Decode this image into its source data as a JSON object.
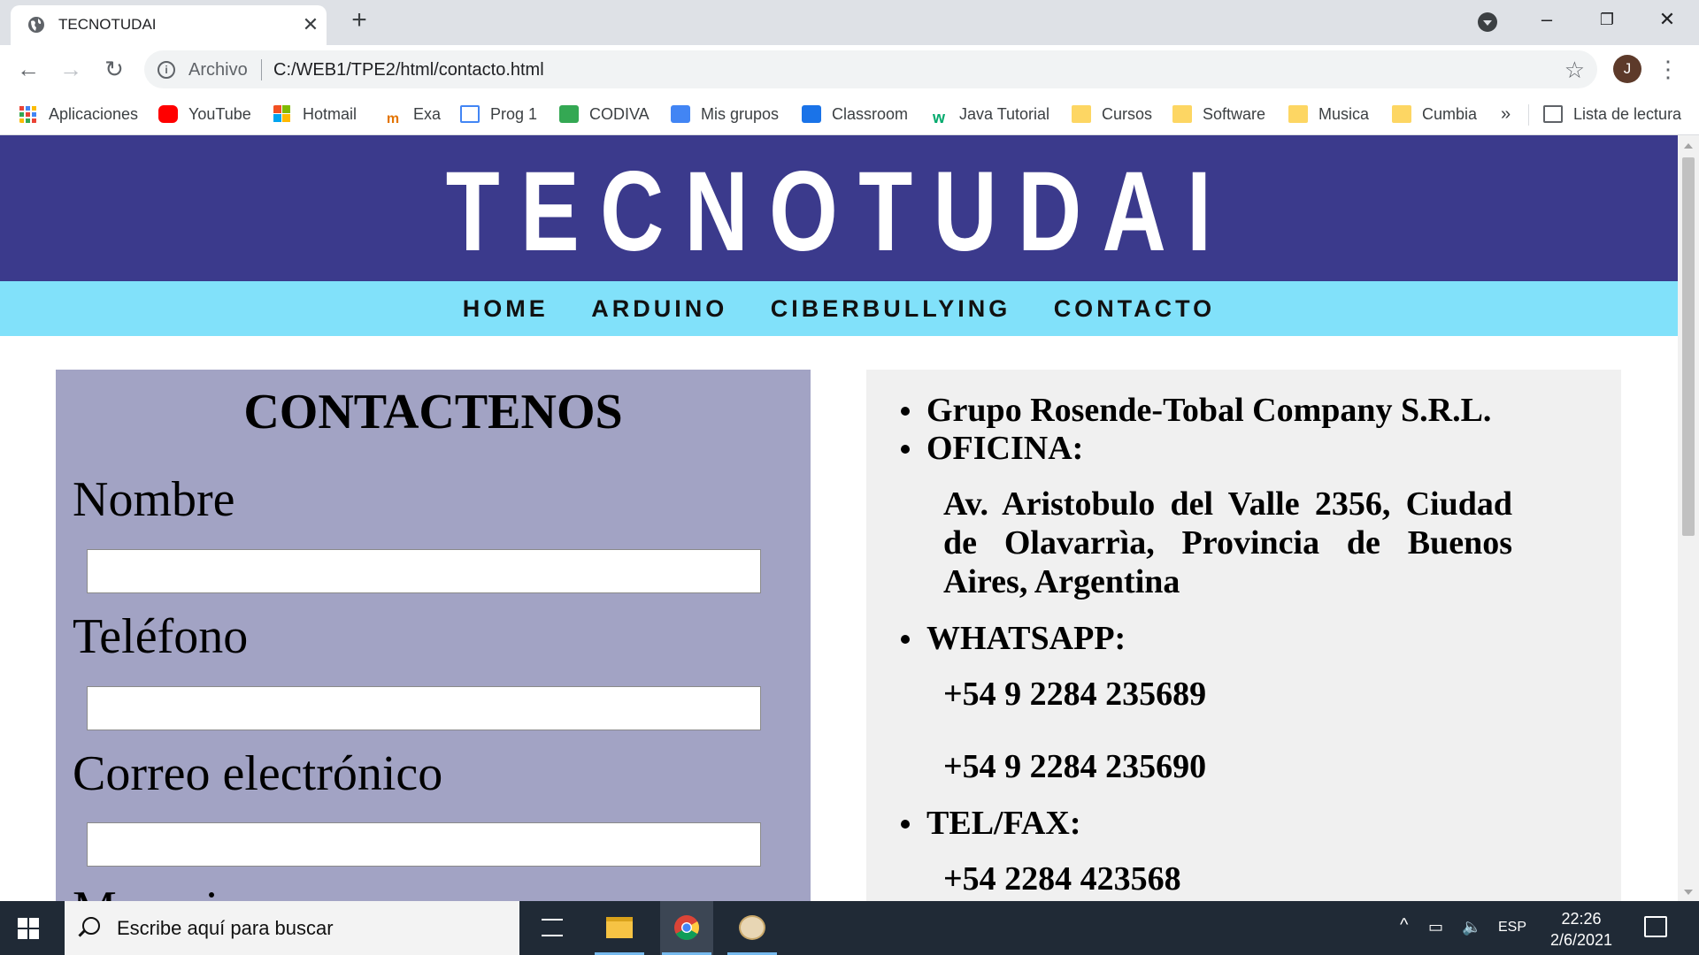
{
  "browser": {
    "tab_title": "TECNOTUDAI",
    "address_label": "Archivo",
    "url": "C:/WEB1/TPE2/html/contacto.html",
    "avatar_letter": "J",
    "bookmarks": [
      {
        "label": "Aplicaciones",
        "icon": "apps-grid-icon",
        "color": "#ea4335"
      },
      {
        "label": "YouTube",
        "icon": "youtube-icon",
        "color": "#ff0000"
      },
      {
        "label": "Hotmail",
        "icon": "microsoft-icon",
        "color": "#f25022"
      },
      {
        "label": "Exa",
        "icon": "exa-icon",
        "color": "#e37400"
      },
      {
        "label": "Prog 1",
        "icon": "prog-icon",
        "color": "#4285f4"
      },
      {
        "label": "CODIVA",
        "icon": "codiva-icon",
        "color": "#34a853"
      },
      {
        "label": "Mis grupos",
        "icon": "groups-icon",
        "color": "#4285f4"
      },
      {
        "label": "Classroom",
        "icon": "classroom-icon",
        "color": "#1a73e8"
      },
      {
        "label": "Java Tutorial",
        "icon": "w3schools-icon",
        "color": "#04aa6d"
      },
      {
        "label": "Cursos",
        "icon": "folder-icon"
      },
      {
        "label": "Software",
        "icon": "folder-icon"
      },
      {
        "label": "Musica",
        "icon": "folder-icon"
      },
      {
        "label": "Cumbia",
        "icon": "folder-icon"
      }
    ],
    "overflow_label": "»",
    "reading_list": "Lista de lectura"
  },
  "site": {
    "title": "TECNOTUDAI",
    "nav": [
      "HOME",
      "ARDUINO",
      "CIBERBULLYING",
      "CONTACTO"
    ],
    "colors": {
      "header": "#3b3a8c",
      "nav": "#81e1fa",
      "form_panel": "#a2a3c4",
      "info_panel": "#f0f0f0"
    }
  },
  "form": {
    "heading": "CONTACTENOS",
    "fields": [
      {
        "label": "Nombre",
        "value": ""
      },
      {
        "label": "Teléfono",
        "value": ""
      },
      {
        "label": "Correo electrónico",
        "value": ""
      },
      {
        "label": "Mensaje",
        "value": ""
      }
    ]
  },
  "contact": {
    "company": "Grupo Rosende-Tobal Company S.R.L.",
    "office_label": "OFICINA:",
    "address": "Av. Aristobulo del Valle 2356, Ciudad de Olavarrìa, Provincia de Buenos Aires, Argentina",
    "whatsapp_label": "WHATSAPP:",
    "whatsapp_numbers": [
      "+54 9 2284 235689",
      "+54 9 2284 235690"
    ],
    "telfax_label": "TEL/FAX:",
    "telfax_number": "+54 2284 423568"
  },
  "taskbar": {
    "search_placeholder": "Escribe aquí para buscar",
    "language": "ESP",
    "time": "22:26",
    "date": "2/6/2021"
  }
}
